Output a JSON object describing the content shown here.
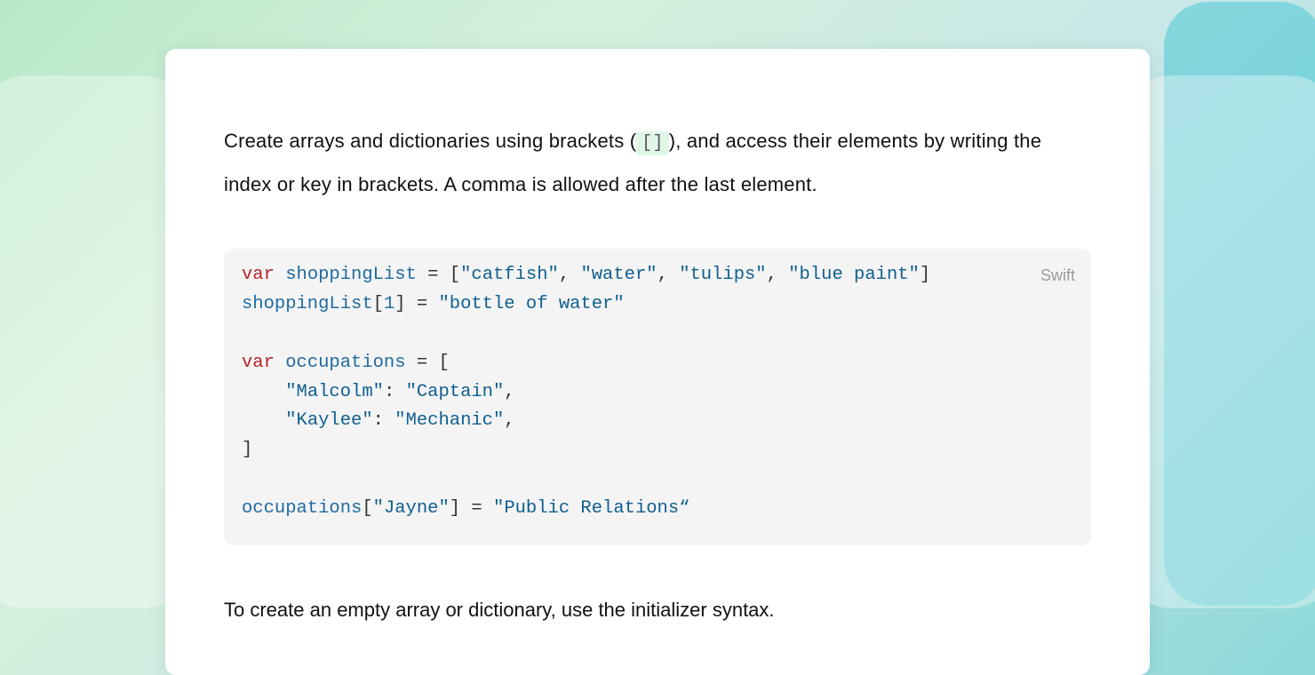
{
  "paragraph": {
    "prefix": "Create arrays and dictionaries using brackets (",
    "inline_code": "[]",
    "suffix": "), and access their elements by writing the index or key in brackets. A comma is allowed after the last element."
  },
  "code": {
    "language_label": "Swift",
    "tokens": {
      "kw_var1": "var",
      "id_shoppingList": "shoppingList",
      "eq": "=",
      "lb": "[",
      "rb": "]",
      "s_catfish": "\"catfish\"",
      "s_water": "\"water\"",
      "s_tulips": "\"tulips\"",
      "s_bluepaint": "\"blue paint\"",
      "idx1": "1",
      "s_bottle": "\"bottle of water\"",
      "kw_var2": "var",
      "id_occupations": "occupations",
      "s_malcolm": "\"Malcolm\"",
      "s_captain": "\"Captain\"",
      "s_kaylee": "\"Kaylee\"",
      "s_mechanic": "\"Mechanic\"",
      "s_jayne": "\"Jayne\"",
      "s_pr": "\"Public Relations“",
      "comma": ",",
      "colon": ":"
    }
  },
  "follow_text": "To create an empty array or dictionary, use the initializer syntax."
}
